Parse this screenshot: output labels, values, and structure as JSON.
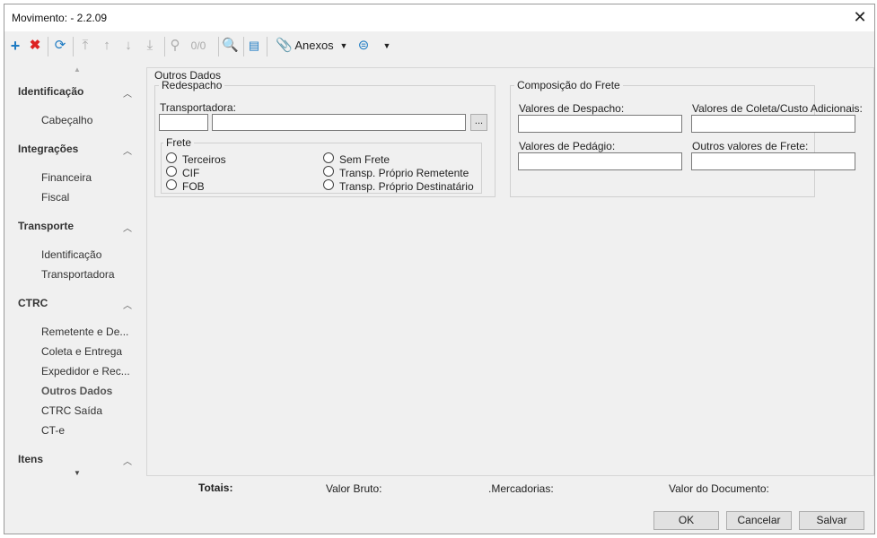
{
  "window": {
    "title": "Movimento:  - 2.2.09"
  },
  "toolbar": {
    "add_icon": "plus-icon",
    "delete_icon": "x-icon",
    "refresh_icon": "refresh-icon",
    "record_counter": "0/0",
    "attachments_label": "Anexos"
  },
  "sidebar": {
    "groups": [
      {
        "title": "Identificação",
        "items": [
          "Cabeçalho"
        ]
      },
      {
        "title": "Integrações",
        "items": [
          "Financeira",
          "Fiscal"
        ]
      },
      {
        "title": "Transporte",
        "items": [
          "Identificação",
          "Transportadora"
        ]
      },
      {
        "title": "CTRC",
        "items": [
          "Remetente e De...",
          "Coleta e Entrega",
          "Expedidor e Rec...",
          "Outros Dados",
          "CTRC Saída",
          "CT-e"
        ]
      },
      {
        "title": "Itens",
        "items": []
      }
    ],
    "active_item": "Outros Dados"
  },
  "main": {
    "section_title": "Outros Dados",
    "redespacho": {
      "legend": "Redespacho",
      "transportadora_label": "Transportadora:",
      "transportadora_code": "",
      "transportadora_name": "",
      "lookup_button": "...",
      "frete": {
        "legend": "Frete",
        "options": [
          "Terceiros",
          "CIF",
          "FOB",
          "Sem Frete",
          "Transp. Próprio Remetente",
          "Transp. Próprio Destinatário"
        ]
      }
    },
    "composicao": {
      "legend": "Composição do Frete",
      "despacho_label": "Valores de Despacho:",
      "coleta_label": "Valores de Coleta/Custo Adicionais:",
      "pedagio_label": "Valores de Pedágio:",
      "outros_label": "Outros valores de Frete:",
      "despacho_value": "",
      "coleta_value": "",
      "pedagio_value": "",
      "outros_value": ""
    }
  },
  "totals": {
    "label": "Totais:",
    "valor_bruto": "Valor Bruto:",
    "mercadorias": ".Mercadorias:",
    "valor_documento": "Valor do Documento:"
  },
  "buttons": {
    "ok": "OK",
    "cancel": "Cancelar",
    "save": "Salvar"
  }
}
